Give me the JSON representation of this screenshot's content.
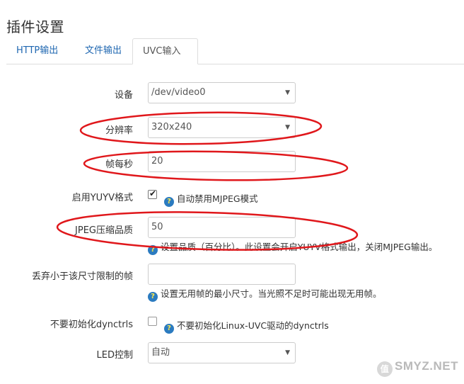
{
  "page": {
    "title": "插件设置"
  },
  "tabs": [
    {
      "label": "HTTP输出",
      "active": false
    },
    {
      "label": "文件输出",
      "active": false
    },
    {
      "label": "UVC输入",
      "active": true
    }
  ],
  "form": {
    "device": {
      "label": "设备",
      "value": "/dev/video0"
    },
    "resolution": {
      "label": "分辨率",
      "value": "320x240"
    },
    "fps": {
      "label": "帧每秒",
      "value": "20"
    },
    "yuyv": {
      "label": "启用YUYV格式",
      "checked": true,
      "help": "自动禁用MJPEG模式"
    },
    "jpeg_quality": {
      "label": "JPEG压缩品质",
      "value": "50",
      "help": "设置品质（百分比）。此设置会开启YUYV格式输出，关闭MJPEG输出。"
    },
    "min_frame": {
      "label": "丢弃小于该尺寸限制的帧",
      "value": "",
      "help": "设置无用帧的最小尺寸。当光照不足时可能出现无用帧。"
    },
    "no_dynctrl": {
      "label": "不要初始化dynctrls",
      "checked": false,
      "help": "不要初始化Linux-UVC驱动的dynctrls"
    },
    "led": {
      "label": "LED控制",
      "value": "自动"
    }
  },
  "icons": {
    "help": "question-icon",
    "caret": "caret-down-icon",
    "check": "check-icon"
  },
  "colors": {
    "tab_link": "#1f67b1",
    "annotation": "#e0171b",
    "help_icon": "#2b7bc0"
  },
  "watermark": {
    "text": "SMYZ.NET"
  }
}
